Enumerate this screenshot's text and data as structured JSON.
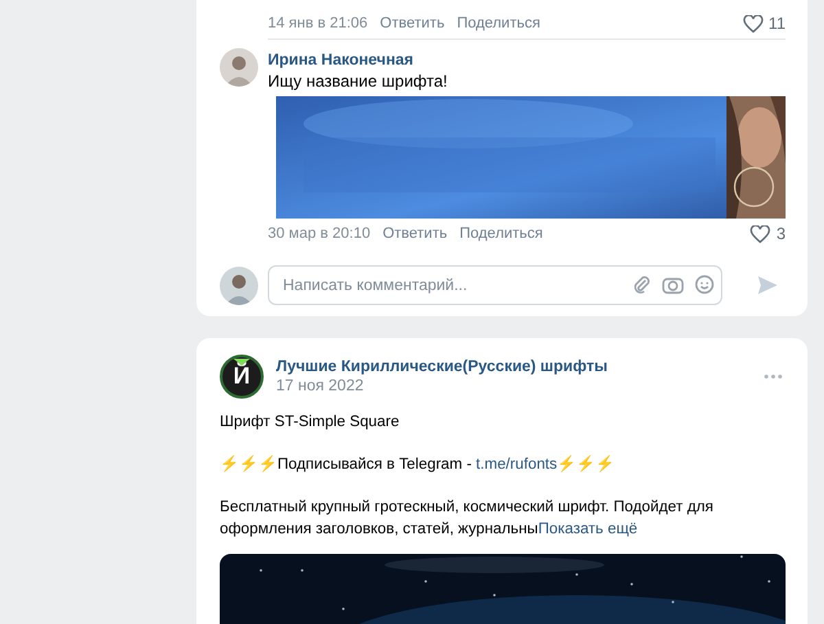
{
  "comments": [
    {
      "time": "14 янв в 21:06",
      "reply": "Ответить",
      "share": "Поделиться",
      "likes": "11"
    },
    {
      "author": "Ирина Наконечная",
      "text": "Ищу название шрифта!",
      "time": "30 мар в 20:10",
      "reply": "Ответить",
      "share": "Поделиться",
      "likes": "3"
    }
  ],
  "composer": {
    "placeholder": "Написать комментарий..."
  },
  "post": {
    "logo": "Й",
    "author": "Лучшие Кириллические(Русские) шрифты",
    "date": "17 ноя 2022",
    "blocks": [
      {
        "kind": "text",
        "text": "Шрифт ST-Simple Square"
      },
      {
        "kind": "promo",
        "prefix": "⚡⚡⚡",
        "text": "Подписывайся в Telegram - ",
        "link": "t.me/rufonts",
        "suffix": "⚡⚡⚡"
      },
      {
        "kind": "teaser",
        "text": "Бесплатный крупный гротескный, космический шрифт. Подойдет для оформления заголовков, статей, журнальны",
        "more": "Показать ещё"
      }
    ]
  }
}
